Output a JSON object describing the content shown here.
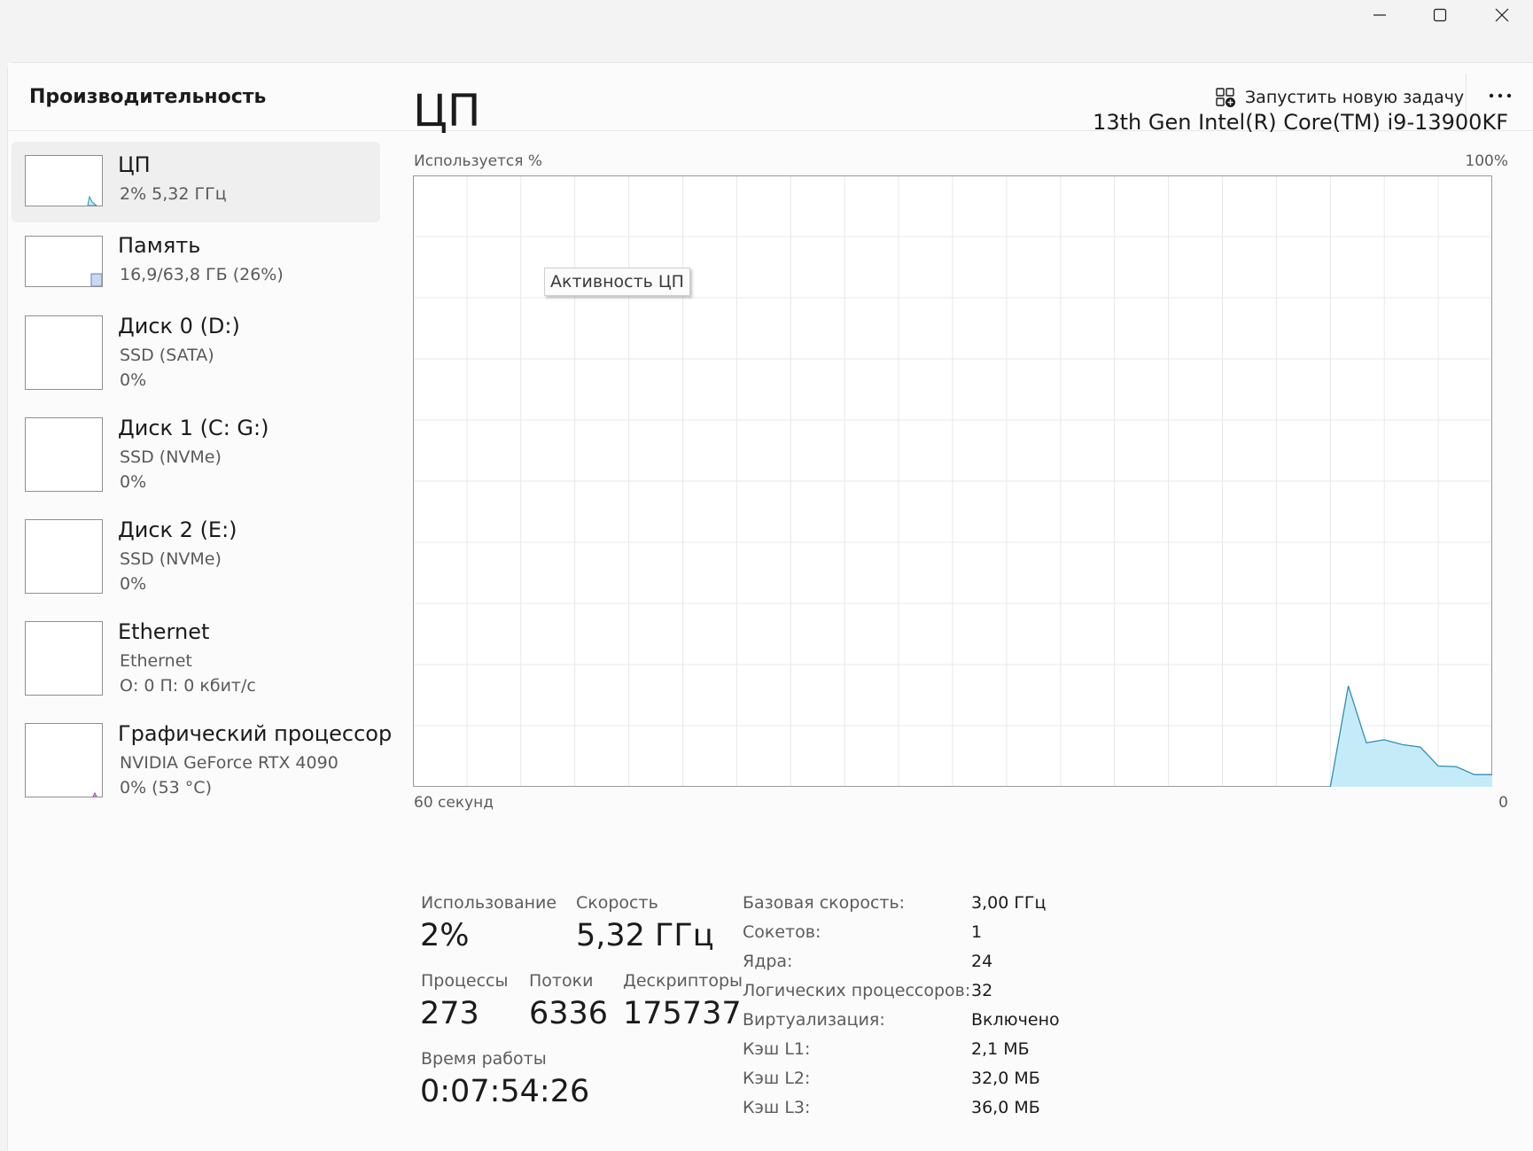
{
  "window": {
    "minimize_icon": "minimize-icon",
    "maximize_icon": "maximize-icon",
    "close_icon": "close-icon"
  },
  "header": {
    "title": "Производительность",
    "run_task_label": "Запустить новую задачу",
    "run_task_icon": "new-task-icon",
    "more_icon": "more-options-icon"
  },
  "sidebar": {
    "items": [
      {
        "title": "ЦП",
        "sub1": "2%  5,32 ГГц",
        "sub2": ""
      },
      {
        "title": "Память",
        "sub1": "16,9/63,8 ГБ (26%)",
        "sub2": ""
      },
      {
        "title": "Диск 0 (D:)",
        "sub1": "SSD (SATA)",
        "sub2": "0%"
      },
      {
        "title": "Диск 1 (C: G:)",
        "sub1": "SSD (NVMe)",
        "sub2": "0%"
      },
      {
        "title": "Диск 2 (E:)",
        "sub1": "SSD (NVMe)",
        "sub2": "0%"
      },
      {
        "title": "Ethernet",
        "sub1": "Ethernet",
        "sub2": "О: 0 П: 0 кбит/с"
      },
      {
        "title": "Графический процессор",
        "sub1": "NVIDIA GeForce RTX 4090",
        "sub2": "0%  (53 °C)"
      }
    ]
  },
  "main": {
    "title": "ЦП",
    "cpu_model": "13th Gen Intel(R) Core(TM) i9-13900KF",
    "tooltip": "Активность ЦП"
  },
  "chart_data": {
    "type": "area",
    "ylabel": "Используется %",
    "y_max_label": "100%",
    "x_left_label": "60 секунд",
    "x_right_label": "0",
    "ylim": [
      0,
      100
    ],
    "xlim": [
      60,
      0
    ],
    "grid": true,
    "x": [
      9.0,
      8.0,
      7.0,
      6.0,
      5.0,
      4.0,
      3.0,
      2.0,
      1.0,
      0.0
    ],
    "values": [
      0,
      16.5,
      7.2,
      7.7,
      6.9,
      6.5,
      3.4,
      3.3,
      2.0,
      2.0
    ],
    "colors": {
      "line": "#2f8fb5",
      "fill": "#c6ebf8",
      "grid": "#e8e8e8",
      "border": "#9a9a9a"
    }
  },
  "stats": {
    "usage_label": "Использование",
    "usage_value": "2%",
    "speed_label": "Скорость",
    "speed_value": "5,32 ГГц",
    "processes_label": "Процессы",
    "processes_value": "273",
    "threads_label": "Потоки",
    "threads_value": "6336",
    "handles_label": "Дескрипторы",
    "handles_value": "175737",
    "uptime_label": "Время работы",
    "uptime_value": "0:07:54:26"
  },
  "specs": [
    {
      "label": "Базовая скорость:",
      "value": "3,00 ГГц"
    },
    {
      "label": "Сокетов:",
      "value": "1"
    },
    {
      "label": "Ядра:",
      "value": "24"
    },
    {
      "label": "Логических процессоров:",
      "value": "32"
    },
    {
      "label": "Виртуализация:",
      "value": "Включено"
    },
    {
      "label": "Кэш L1:",
      "value": "2,1 МБ"
    },
    {
      "label": "Кэш L2:",
      "value": "32,0 МБ"
    },
    {
      "label": "Кэш L3:",
      "value": "36,0 МБ"
    }
  ]
}
